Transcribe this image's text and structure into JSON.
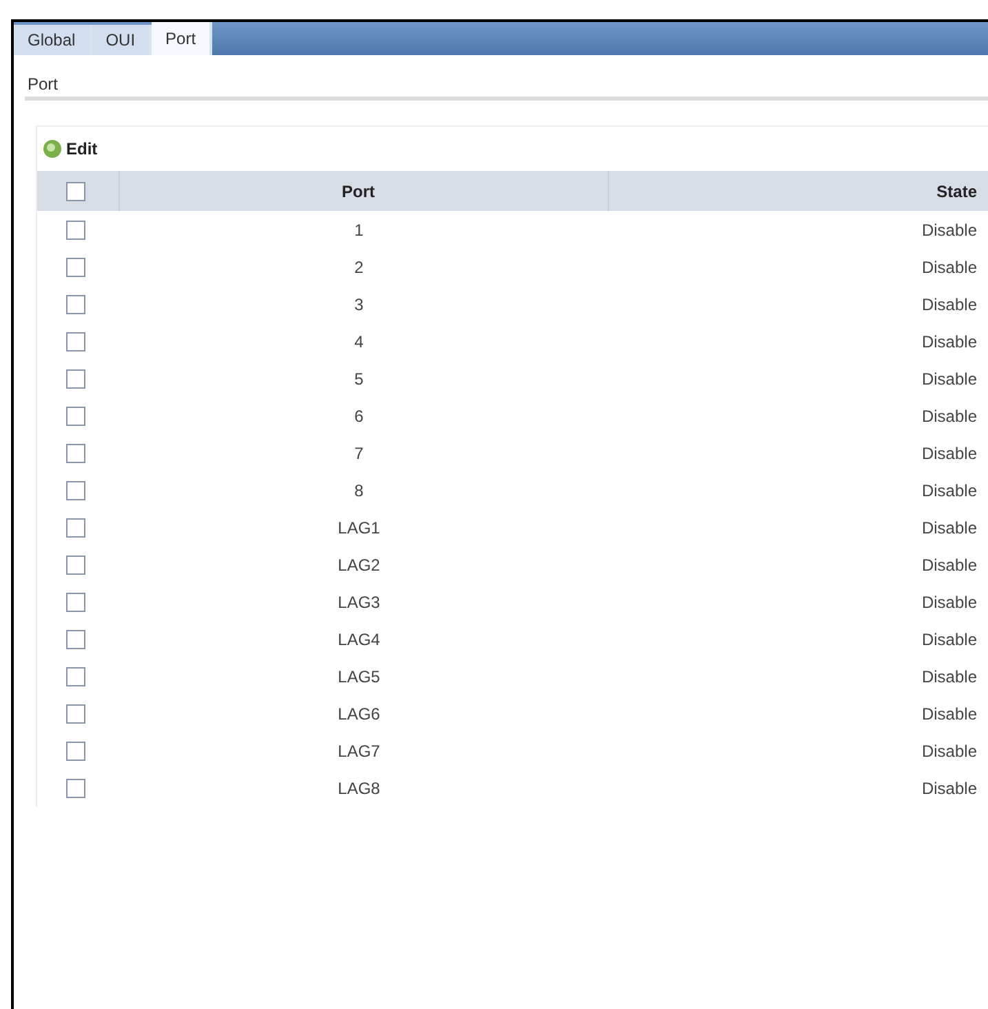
{
  "tabs": [
    {
      "label": "Global",
      "selected": false
    },
    {
      "label": "OUI",
      "selected": false
    },
    {
      "label": "Port",
      "selected": true
    }
  ],
  "section_title": "Port",
  "toolbar": {
    "edit_label": "Edit"
  },
  "table": {
    "columns": [
      "Port",
      "State"
    ],
    "header_checked": false,
    "rows": [
      {
        "port": "1",
        "state": "Disable",
        "checked": false
      },
      {
        "port": "2",
        "state": "Disable",
        "checked": false
      },
      {
        "port": "3",
        "state": "Disable",
        "checked": false
      },
      {
        "port": "4",
        "state": "Disable",
        "checked": false
      },
      {
        "port": "5",
        "state": "Disable",
        "checked": false
      },
      {
        "port": "6",
        "state": "Disable",
        "checked": false
      },
      {
        "port": "7",
        "state": "Disable",
        "checked": false
      },
      {
        "port": "8",
        "state": "Disable",
        "checked": false
      },
      {
        "port": "LAG1",
        "state": "Disable",
        "checked": false
      },
      {
        "port": "LAG2",
        "state": "Disable",
        "checked": false
      },
      {
        "port": "LAG3",
        "state": "Disable",
        "checked": false
      },
      {
        "port": "LAG4",
        "state": "Disable",
        "checked": false
      },
      {
        "port": "LAG5",
        "state": "Disable",
        "checked": false
      },
      {
        "port": "LAG6",
        "state": "Disable",
        "checked": false
      },
      {
        "port": "LAG7",
        "state": "Disable",
        "checked": false
      },
      {
        "port": "LAG8",
        "state": "Disable",
        "checked": false
      }
    ]
  }
}
